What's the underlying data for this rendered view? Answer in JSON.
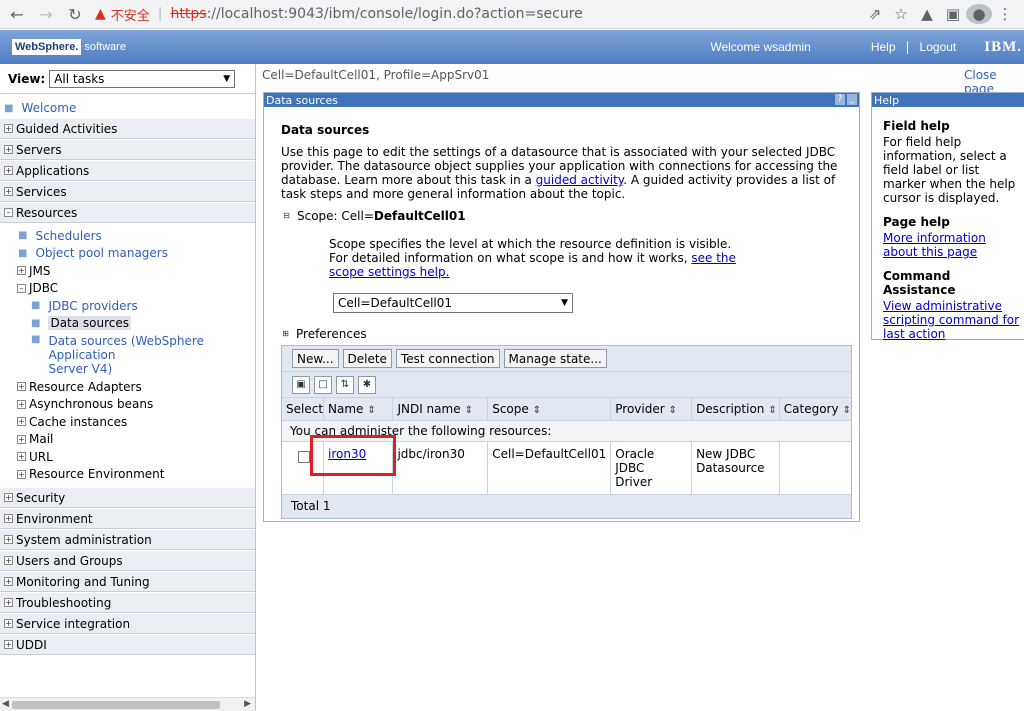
{
  "browser": {
    "insecure_label": "不安全",
    "url_scheme": "https",
    "url_rest": "://localhost:9043/ibm/console/login.do?action=secure"
  },
  "banner": {
    "logo_word": "WebSphere.",
    "logo_suffix": "software",
    "welcome": "Welcome wsadmin",
    "help": "Help",
    "logout": "Logout",
    "ibm": "IBM."
  },
  "nav": {
    "view_label": "View:",
    "view_value": "All tasks",
    "welcome": "Welcome",
    "categories": [
      "Guided Activities",
      "Servers",
      "Applications",
      "Services",
      "Resources"
    ],
    "resources": {
      "schedulers": "Schedulers",
      "object_pool": "Object pool managers",
      "jms": "JMS",
      "jdbc": "JDBC",
      "jdbc_providers": "JDBC providers",
      "data_sources": "Data sources",
      "data_sources_v4_line1": "Data sources (WebSphere Application",
      "data_sources_v4_line2": "Server V4)",
      "resource_adapters": "Resource Adapters",
      "async_beans": "Asynchronous beans",
      "cache_instances": "Cache instances",
      "mail": "Mail",
      "url": "URL",
      "resource_env": "Resource Environment"
    },
    "bottom_categories": [
      "Security",
      "Environment",
      "System administration",
      "Users and Groups",
      "Monitoring and Tuning",
      "Troubleshooting",
      "Service integration",
      "UDDI"
    ]
  },
  "main": {
    "breadcrumb": "Cell=DefaultCell01, Profile=AppSrv01",
    "close_page": "Close page",
    "panel_title": "Data sources",
    "heading": "Data sources",
    "desc_part1": "Use this page to edit the settings of a datasource that is associated with your selected JDBC provider. The datasource object supplies your application with connections for accessing the database. Learn more about this task in a ",
    "desc_link": "guided activity",
    "desc_part2": ". A guided activity provides a list of task steps and more general information about the topic.",
    "scope_label": "Scope: Cell=",
    "scope_value": "DefaultCell01",
    "scope_text1": "Scope specifies the level at which the resource definition is visible.",
    "scope_text2": "For detailed information on what scope is and how it works, ",
    "scope_link1": "see the",
    "scope_link2": "scope settings help.",
    "scope_select": "Cell=DefaultCell01",
    "preferences": "Preferences",
    "buttons": {
      "new": "New...",
      "delete": "Delete",
      "test": "Test connection",
      "manage": "Manage state..."
    },
    "columns": [
      "Select",
      "Name",
      "JNDI name",
      "Scope",
      "Provider",
      "Description",
      "Category"
    ],
    "admin_text": "You can administer the following resources:",
    "rows": [
      {
        "name": "iron30",
        "jndi": "jdbc/iron30",
        "scope": "Cell=DefaultCell01",
        "provider_l1": "Oracle JDBC",
        "provider_l2": "Driver",
        "desc_l1": "New JDBC",
        "desc_l2": "Datasource",
        "category": ""
      }
    ],
    "total": "Total 1"
  },
  "help": {
    "title": "Help",
    "field_help_title": "Field help",
    "field_help_text": "For field help information, select a field label or list marker when the help cursor is displayed.",
    "page_help_title": "Page help",
    "page_help_link": "More information about this page",
    "cmd_title": "Command Assistance",
    "cmd_link": "View administrative scripting command for last action"
  },
  "colors": {
    "banner": "#4f7cc3",
    "panel_head": "#3f74b8",
    "highlight": "#e01e24"
  }
}
